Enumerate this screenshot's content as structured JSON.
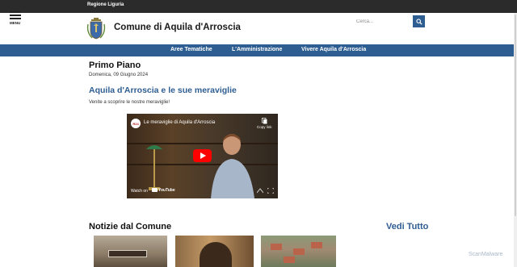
{
  "topbar": {
    "region_label": "Regione Liguria"
  },
  "header": {
    "menu_label": "MENU",
    "site_title": "Comune di Aquila d'Arroscia",
    "search_placeholder": "Cerca..."
  },
  "nav": {
    "items": [
      "Aree Tematiche",
      "L'Amministrazione",
      "Vivere Aquila d'Arroscia"
    ]
  },
  "primo_piano": {
    "heading": "Primo Piano",
    "date": "Domenica, 09 Giugno 2024",
    "article_title": "Aquila d'Arroscia e le sue meraviglie",
    "article_text": "Venite a scoprire le nostre meraviglie!"
  },
  "video": {
    "channel_logo": "R24",
    "title": "Le meraviglie di Aquila d'Arroscia",
    "copy_label": "Copy link",
    "watch_label": "Watch on",
    "platform": "YouTube"
  },
  "news": {
    "heading": "Notizie dal Comune",
    "view_all": "Vedi Tutto"
  },
  "watermark": "ScanMalware",
  "colors": {
    "brand_blue": "#2e5d91",
    "topbar": "#2b2b2b",
    "play_red": "#ff0000"
  },
  "icons": [
    "hamburger-icon",
    "search-icon",
    "copy-icon",
    "play-icon",
    "fullscreen-icon"
  ]
}
